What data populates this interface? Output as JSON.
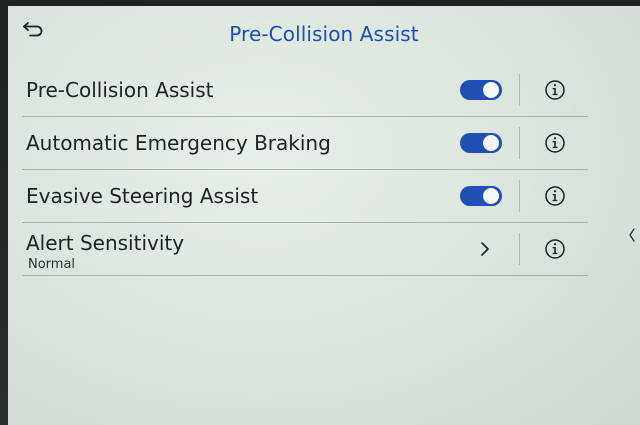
{
  "header": {
    "title": "Pre-Collision Assist",
    "back_icon": "back-arrow-icon"
  },
  "settings": [
    {
      "label": "Pre-Collision Assist",
      "type": "toggle",
      "enabled": true,
      "info_icon": "info-icon"
    },
    {
      "label": "Automatic Emergency Braking",
      "type": "toggle",
      "enabled": true,
      "info_icon": "info-icon"
    },
    {
      "label": "Evasive Steering Assist",
      "type": "toggle",
      "enabled": true,
      "info_icon": "info-icon"
    },
    {
      "label": "Alert Sensitivity",
      "value": "Normal",
      "type": "submenu",
      "chevron_icon": "chevron-right-icon",
      "info_icon": "info-icon"
    }
  ],
  "colors": {
    "accent": "#1f4fb3",
    "title": "#1d4fb8",
    "screen_bg": "#e2eae3",
    "text": "#1e2220"
  }
}
